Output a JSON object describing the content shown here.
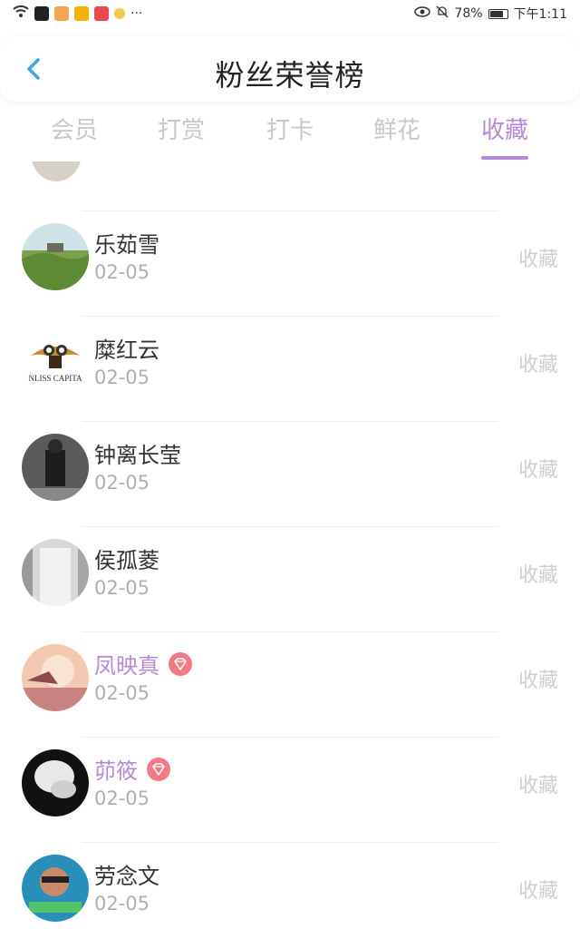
{
  "status_bar": {
    "battery": "78%",
    "time": "下午1:11",
    "icons": [
      "wifi-icon",
      "signal-icon",
      "app-icon",
      "app-icon",
      "app-icon",
      "app-icon",
      "app-icon",
      "more-dots-icon",
      "eye-icon",
      "mute-bell-icon",
      "battery-icon"
    ]
  },
  "header": {
    "title": "粉丝荣誉榜",
    "back_icon": "chevron-left-icon"
  },
  "tabs": [
    {
      "label": "会员",
      "active": false
    },
    {
      "label": "打赏",
      "active": false
    },
    {
      "label": "打卡",
      "active": false
    },
    {
      "label": "鲜花",
      "active": false
    },
    {
      "label": "收藏",
      "active": true
    }
  ],
  "list": [
    {
      "name": "乐茹雪",
      "date": "02-05",
      "action": "收藏",
      "vip": false
    },
    {
      "name": "糜红云",
      "date": "02-05",
      "action": "收藏",
      "vip": false,
      "avatar_text": "NLISS CAPITA"
    },
    {
      "name": "钟离长莹",
      "date": "02-05",
      "action": "收藏",
      "vip": false
    },
    {
      "name": "侯孤菱",
      "date": "02-05",
      "action": "收藏",
      "vip": false
    },
    {
      "name": "凤映真",
      "date": "02-05",
      "action": "收藏",
      "vip": true
    },
    {
      "name": "茆筱",
      "date": "02-05",
      "action": "收藏",
      "vip": true
    },
    {
      "name": "劳念文",
      "date": "02-05",
      "action": "收藏",
      "vip": false
    }
  ],
  "colors": {
    "accent": "#b58ad6",
    "badge": "#f07b85",
    "back": "#3aa3e3",
    "inactive_tab": "#c8c8c8"
  }
}
